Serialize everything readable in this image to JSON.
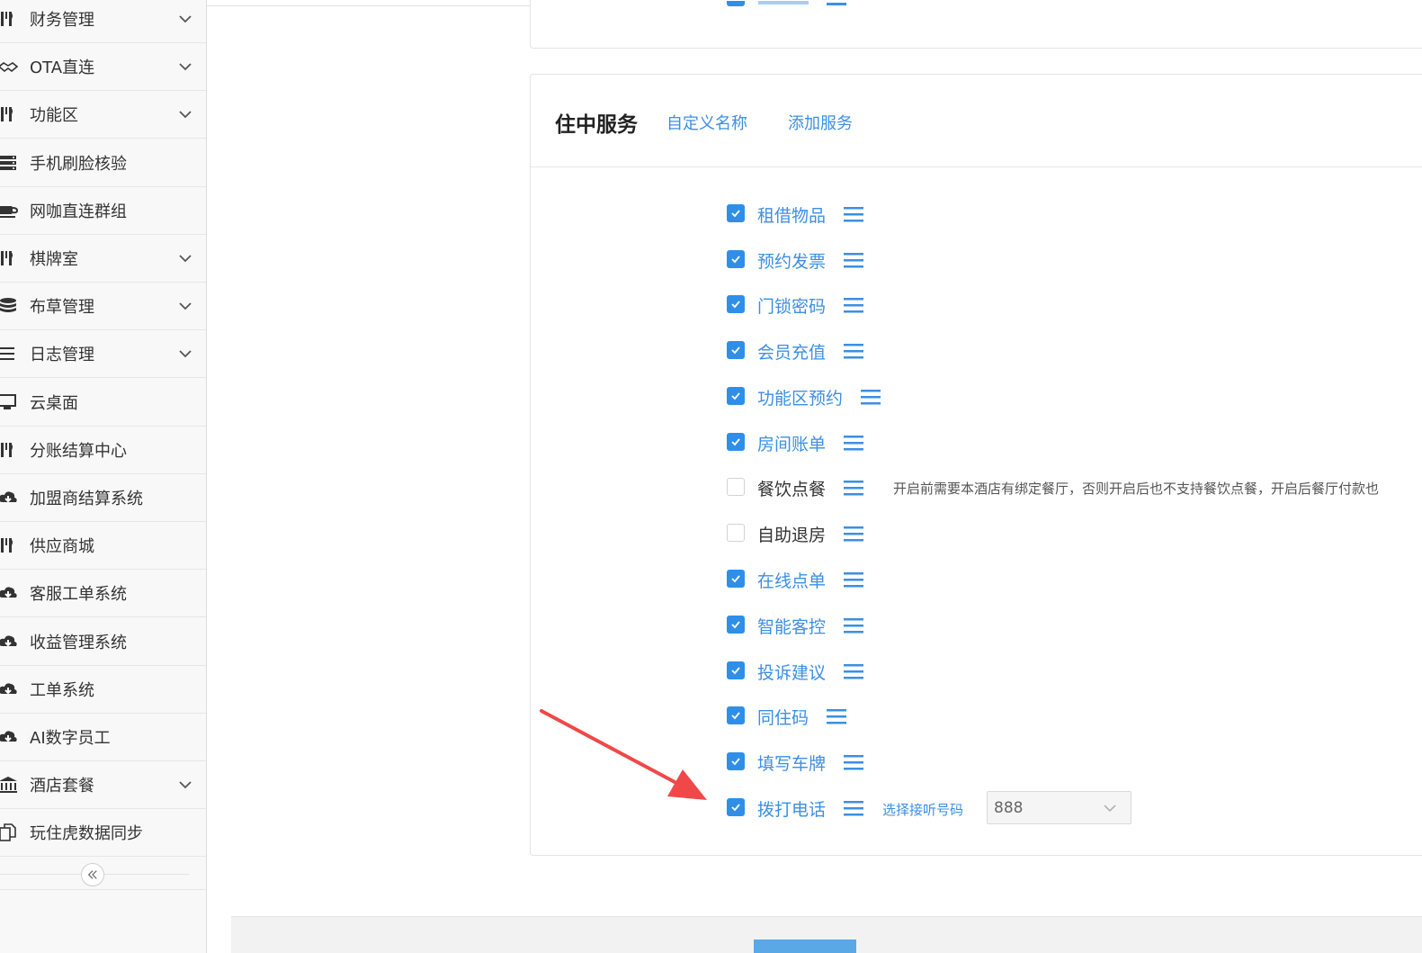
{
  "sidebar": {
    "items": [
      {
        "label": "财务管理",
        "icon": "utensils-icon",
        "expandable": true
      },
      {
        "label": "OTA直连",
        "icon": "handshake-icon",
        "expandable": true
      },
      {
        "label": "功能区",
        "icon": "utensils-icon",
        "expandable": true
      },
      {
        "label": "手机刷脸核验",
        "icon": "server-icon",
        "expandable": false
      },
      {
        "label": "网咖直连群组",
        "icon": "coffee-icon",
        "expandable": false
      },
      {
        "label": "棋牌室",
        "icon": "utensils-icon",
        "expandable": true
      },
      {
        "label": "布草管理",
        "icon": "database-icon",
        "expandable": true
      },
      {
        "label": "日志管理",
        "icon": "list-icon",
        "expandable": true
      },
      {
        "label": "云桌面",
        "icon": "monitor-icon",
        "expandable": false
      },
      {
        "label": "分账结算中心",
        "icon": "utensils-icon",
        "expandable": false
      },
      {
        "label": "加盟商结算系统",
        "icon": "cloud-download-icon",
        "expandable": false
      },
      {
        "label": "供应商城",
        "icon": "utensils-icon",
        "expandable": false
      },
      {
        "label": "客服工单系统",
        "icon": "cloud-download-icon",
        "expandable": false
      },
      {
        "label": "收益管理系统",
        "icon": "cloud-download-icon",
        "expandable": false
      },
      {
        "label": "工单系统",
        "icon": "cloud-download-icon",
        "expandable": false
      },
      {
        "label": "AI数字员工",
        "icon": "cloud-download-icon",
        "expandable": false
      },
      {
        "label": "酒店套餐",
        "icon": "bank-icon",
        "expandable": true
      },
      {
        "label": "玩住虎数据同步",
        "icon": "copy-icon",
        "expandable": false
      }
    ],
    "collapse_icon": "double-chevron-left-icon"
  },
  "card": {
    "title": "住中服务",
    "link_rename": "自定义名称",
    "link_add": "添加服务"
  },
  "services": [
    {
      "label": "租借物品",
      "checked": true
    },
    {
      "label": "预约发票",
      "checked": true
    },
    {
      "label": "门锁密码",
      "checked": true
    },
    {
      "label": "会员充值",
      "checked": true
    },
    {
      "label": "功能区预约",
      "checked": true
    },
    {
      "label": "房间账单",
      "checked": true
    },
    {
      "label": "餐饮点餐",
      "checked": false,
      "note": "开启前需要本酒店有绑定餐厅，否则开启后也不支持餐饮点餐，开启后餐厅付款也"
    },
    {
      "label": "自助退房",
      "checked": false
    },
    {
      "label": "在线点单",
      "checked": true
    },
    {
      "label": "智能客控",
      "checked": true
    },
    {
      "label": "投诉建议",
      "checked": true
    },
    {
      "label": "同住码",
      "checked": true
    },
    {
      "label": "填写车牌",
      "checked": true
    },
    {
      "label": "拨打电话",
      "checked": true
    }
  ],
  "phone": {
    "label": "选择接听号码",
    "value": "888"
  },
  "colors": {
    "accent": "#2f8fe8",
    "link": "#3b8fe4",
    "annotation_arrow": "#f04848"
  }
}
